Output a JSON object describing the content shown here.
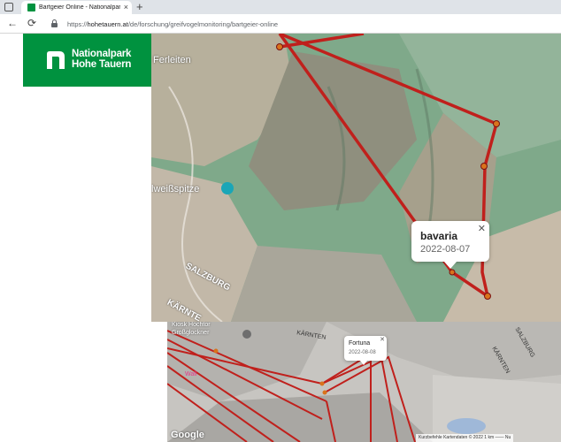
{
  "browser": {
    "tab_title": "Bartgeier Online - Nationalpark Ho",
    "tab_close": "×",
    "new_tab": "+",
    "back": "←",
    "reload": "⟳",
    "url_prefix": "https://",
    "url_domain": "hohetauern.at",
    "url_path": "/de/forschung/greifvogelmonitoring/bartgeier-online"
  },
  "logo": {
    "line1": "Nationalpark",
    "line2": "Hohe Tauern",
    "color": "#00923f"
  },
  "map_top": {
    "labels": {
      "ferleiten": "Ferleiten",
      "edelweiss": "lweißspitze",
      "salzburg": "SALZBURG",
      "kaernten": "KÄRNTE"
    },
    "popup": {
      "name": "bavaria",
      "date": "2022-08-07",
      "close": "✕"
    },
    "track_color": "#c0201c"
  },
  "map_bottom": {
    "labels": {
      "kiosk": "Kiosk Hochtor",
      "grossglockner": "Großglockner",
      "kaernten": "KÄRNTEN",
      "salzburg": "SALZBURG",
      "kaernten_vertical": "KÄRNTEN",
      "walk": "Wall"
    },
    "popup": {
      "name": "Fortuna",
      "date": "2022-08-08",
      "close": "✕"
    },
    "google": "Google",
    "attribution": "Kurzbefehle   Kartendaten © 2022   1 km ——   Nu"
  }
}
